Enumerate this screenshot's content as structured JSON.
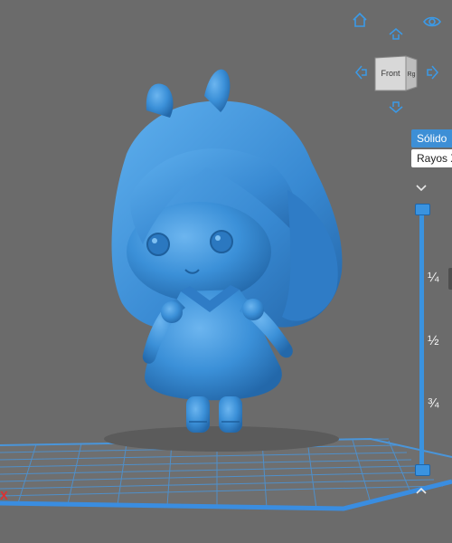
{
  "viewport": {
    "background": "#6b6b6b",
    "model_color": "#3b90d8",
    "grid_color": "#4a95d9",
    "axis_label": "X"
  },
  "view_controls": {
    "home_icon": "home-icon",
    "visibility_icon": "eye-icon",
    "rotate_up_icon": "arrow-up-icon",
    "rotate_down_icon": "arrow-down-icon",
    "rotate_left_icon": "arrow-left-icon",
    "rotate_right_icon": "arrow-right-icon",
    "cube": {
      "front_label": "Front",
      "right_label": "Rg"
    }
  },
  "render_modes": {
    "solid": "Sólido",
    "xray": "Rayos X",
    "active": "Sólido"
  },
  "slice_slider": {
    "labels": [
      "¼",
      "½",
      "¾"
    ],
    "top_value": 0,
    "bottom_value": 1
  }
}
